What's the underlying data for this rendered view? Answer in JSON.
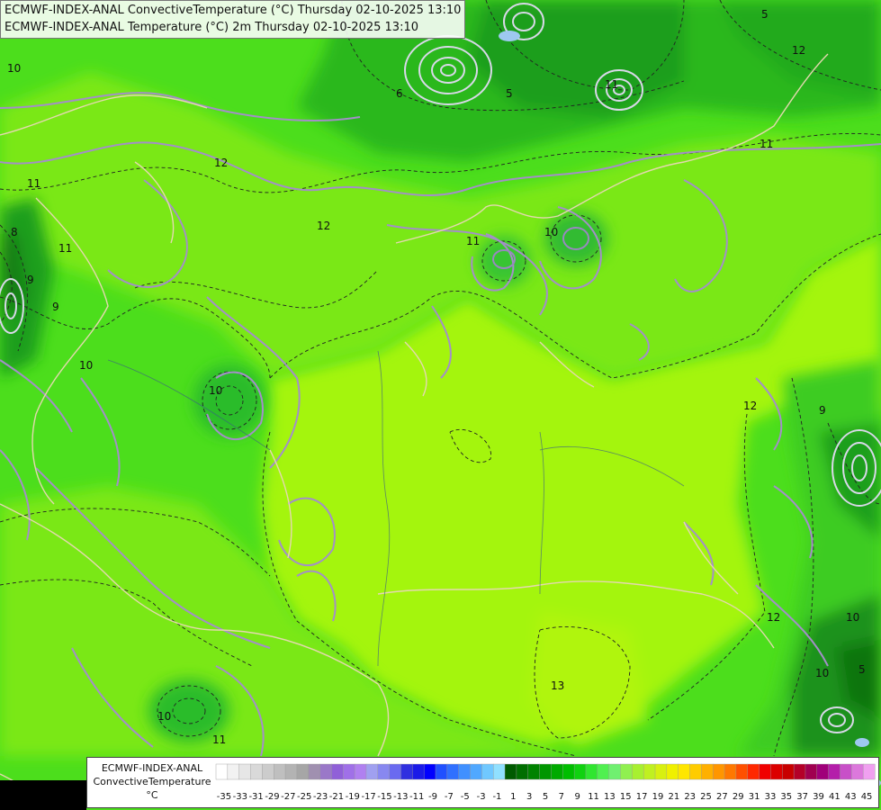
{
  "title": {
    "line1": "ECMWF-INDEX-ANAL ConvectiveTemperature (°C) Thursday 02-10-2025 13:10",
    "line2": "ECMWF-INDEX-ANAL Temperature (°C) 2m Thursday 02-10-2025 13:10"
  },
  "legend": {
    "line1": "ECMWF-INDEX-ANAL",
    "line2": "ConvectiveTemperature",
    "unit": "°C",
    "colors": [
      "#ffffff",
      "#f2f2f2",
      "#e6e6e6",
      "#d9d9d9",
      "#cccccc",
      "#bfbfbf",
      "#b3b3b3",
      "#a6a6a6",
      "#a090b0",
      "#9a78c8",
      "#9060d8",
      "#a070e8",
      "#b080f0",
      "#a0a0f0",
      "#8888f0",
      "#6a6af0",
      "#3030e0",
      "#1a1ae8",
      "#0000ff",
      "#2050ff",
      "#3070ff",
      "#4090ff",
      "#50a8ff",
      "#70c8ff",
      "#90e0ff",
      "#005a00",
      "#006e00",
      "#008200",
      "#009600",
      "#00aa00",
      "#00be00",
      "#10d210",
      "#30e630",
      "#50f050",
      "#70f070",
      "#90f050",
      "#a8f030",
      "#c0f020",
      "#d8f010",
      "#f0f000",
      "#ffe600",
      "#ffcc00",
      "#ffb000",
      "#ff9600",
      "#ff7800",
      "#ff5000",
      "#ff2800",
      "#f00000",
      "#dc0000",
      "#c80000",
      "#b40028",
      "#a00050",
      "#a0007a",
      "#b41eaa",
      "#c850c8",
      "#dc78dc",
      "#f0a0f0"
    ],
    "ticks": [
      "-35",
      "-33",
      "-31",
      "-29",
      "-27",
      "-25",
      "-23",
      "-21",
      "-19",
      "-17",
      "-15",
      "-13",
      "-11",
      "-9",
      "-7",
      "-5",
      "-3",
      "-1",
      "1",
      "3",
      "5",
      "7",
      "9",
      "11",
      "13",
      "15",
      "17",
      "19",
      "21",
      "23",
      "25",
      "27",
      "29",
      "31",
      "33",
      "35",
      "37",
      "39",
      "41",
      "43",
      "45"
    ]
  },
  "contour_labels": [
    "5",
    "6",
    "10",
    "11",
    "12",
    "11",
    "12",
    "10",
    "9",
    "10",
    "11",
    "12",
    "10",
    "9",
    "8",
    "10",
    "11",
    "11",
    "11",
    "5",
    "9",
    "12",
    "10",
    "13",
    "12",
    "10",
    "5"
  ]
}
